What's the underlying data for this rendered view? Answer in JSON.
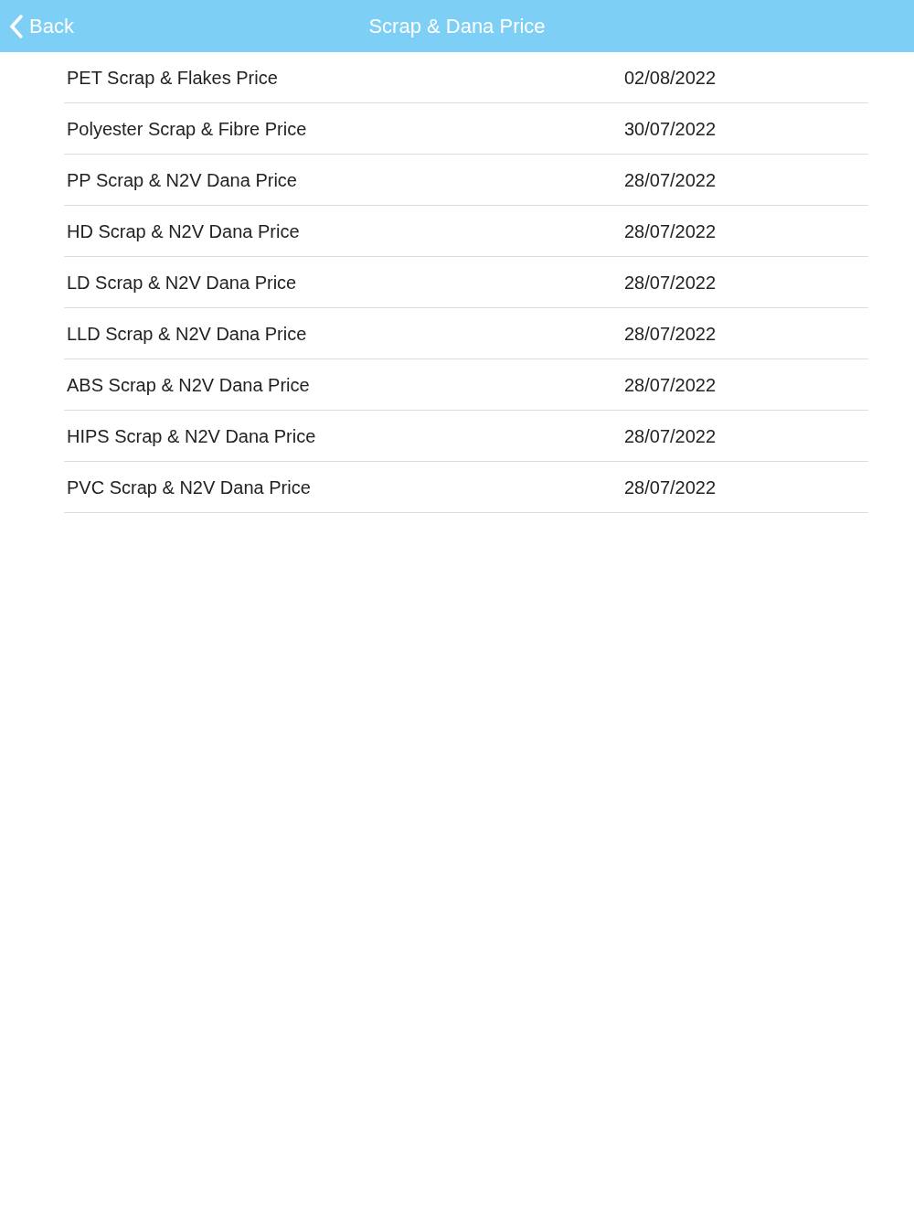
{
  "header": {
    "back_label": "Back",
    "title": "Scrap & Dana Price"
  },
  "items": [
    {
      "name": "PET Scrap & Flakes Price",
      "date": "02/08/2022"
    },
    {
      "name": "Polyester Scrap & Fibre Price",
      "date": "30/07/2022"
    },
    {
      "name": "PP Scrap & N2V Dana Price",
      "date": "28/07/2022"
    },
    {
      "name": "HD Scrap & N2V Dana Price",
      "date": "28/07/2022"
    },
    {
      "name": "LD Scrap & N2V Dana Price",
      "date": "28/07/2022"
    },
    {
      "name": "LLD Scrap & N2V Dana Price",
      "date": "28/07/2022"
    },
    {
      "name": "ABS Scrap & N2V Dana Price",
      "date": "28/07/2022"
    },
    {
      "name": "HIPS Scrap & N2V Dana Price",
      "date": "28/07/2022"
    },
    {
      "name": "PVC Scrap & N2V Dana Price",
      "date": "28/07/2022"
    }
  ]
}
